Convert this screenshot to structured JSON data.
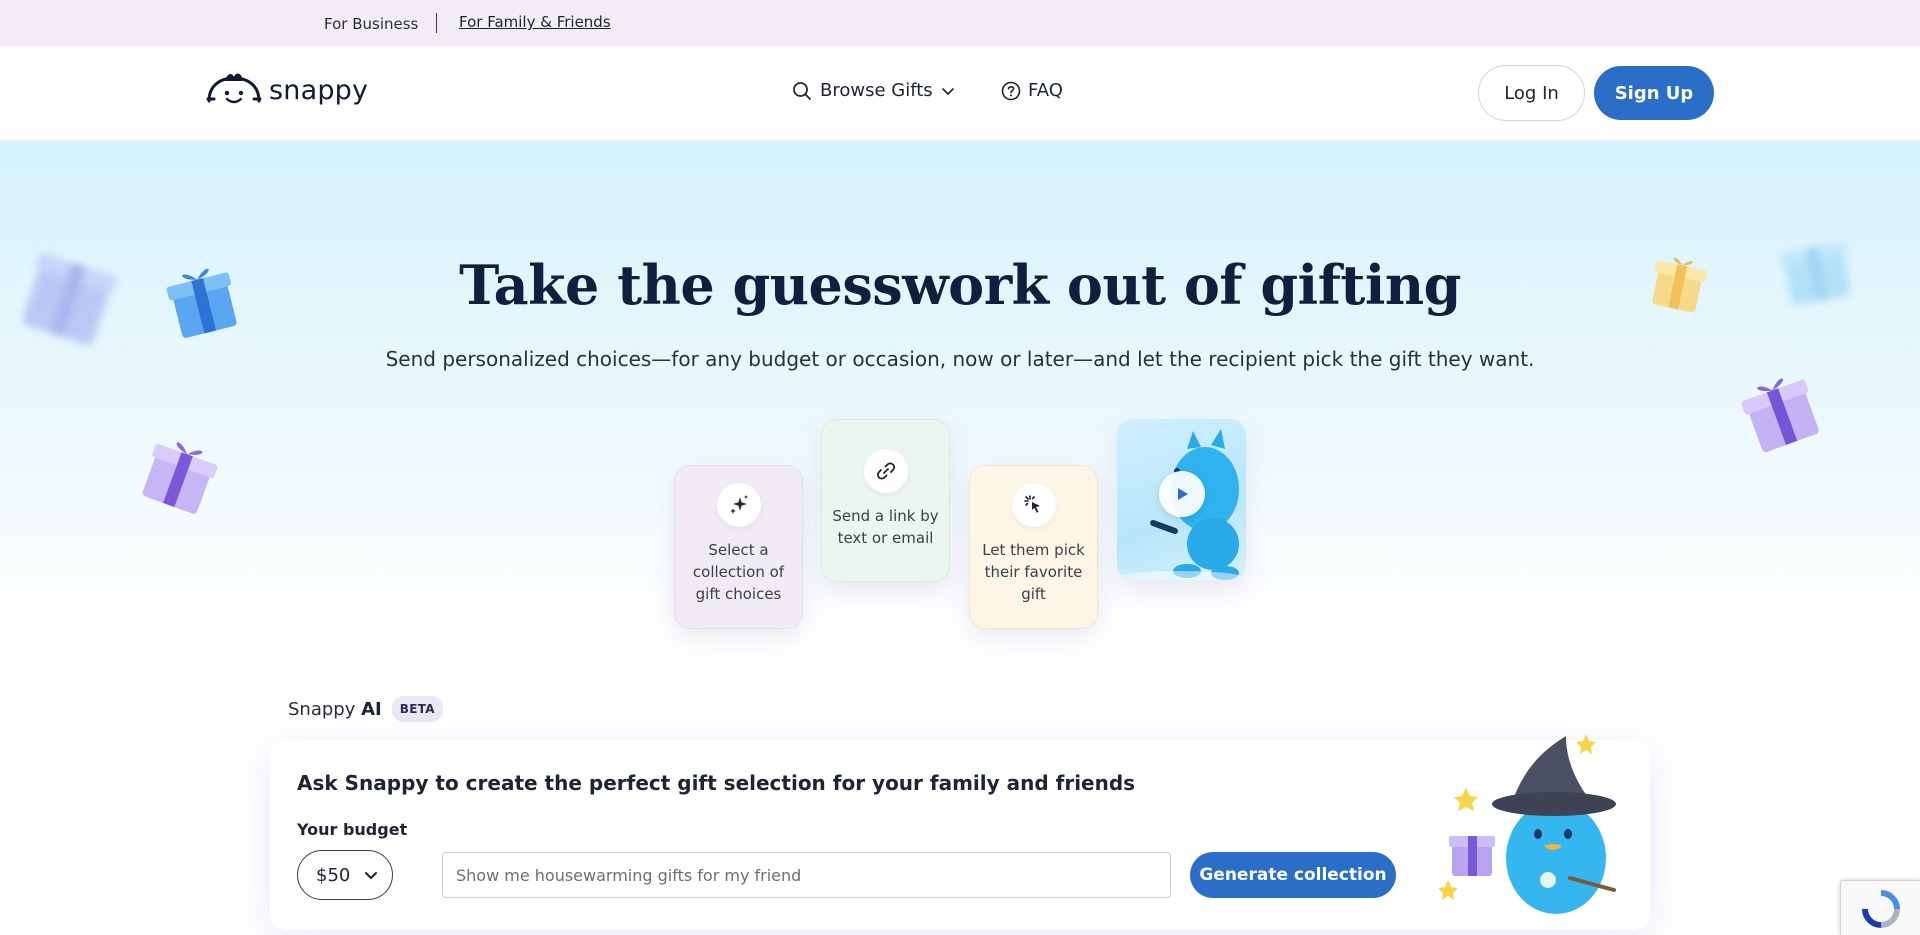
{
  "topbar": {
    "business": "For Business",
    "family": "For Family & Friends"
  },
  "header": {
    "logo_text": "snappy",
    "browse": "Browse Gifts",
    "faq": "FAQ",
    "login": "Log In",
    "signup": "Sign Up"
  },
  "hero": {
    "title": "Take the guesswork out of gifting",
    "subtitle": "Send personalized choices—for any budget or occasion, now or later—and let the recipient pick the gift they want.",
    "steps": [
      {
        "text": "Select a collection of gift choices",
        "icon": "sparkles-icon"
      },
      {
        "text": "Send a link by text or email",
        "icon": "link-icon"
      },
      {
        "text": "Let them pick their favorite gift",
        "icon": "cursor-click-icon"
      }
    ]
  },
  "ai": {
    "label": "Snappy",
    "label_bold": "AI",
    "badge": "BETA",
    "title": "Ask Snappy to create the perfect gift selection for your family and friends",
    "budget_label": "Your budget",
    "budget_value": "$50",
    "placeholder": "Show me housewarming gifts for my friend",
    "generate": "Generate collection"
  },
  "colors": {
    "primary": "#2a6ec8",
    "topbar_bg": "#f1ecf8",
    "heading": "#0f1f3d"
  }
}
